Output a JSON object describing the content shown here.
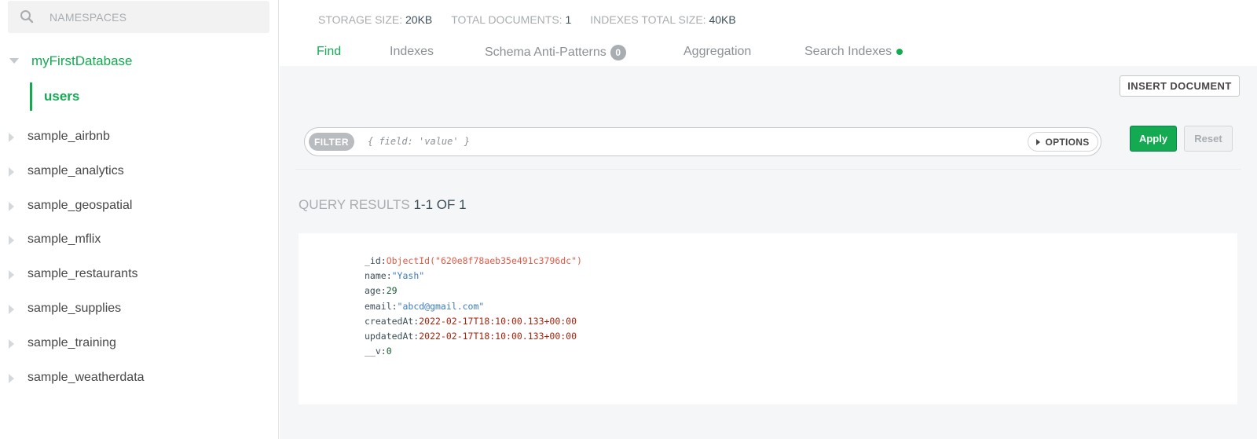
{
  "sidebar": {
    "search_label": "NAMESPACES",
    "active_database": "myFirstDatabase",
    "active_collection": "users",
    "databases": [
      {
        "label": "sample_airbnb"
      },
      {
        "label": "sample_analytics"
      },
      {
        "label": "sample_geospatial"
      },
      {
        "label": "sample_mflix"
      },
      {
        "label": "sample_restaurants"
      },
      {
        "label": "sample_supplies"
      },
      {
        "label": "sample_training"
      },
      {
        "label": "sample_weatherdata"
      }
    ]
  },
  "stats": {
    "storage_label": "STORAGE SIZE:",
    "storage_value": "20KB",
    "docs_label": "TOTAL DOCUMENTS:",
    "docs_value": "1",
    "indexes_label": "INDEXES TOTAL SIZE:",
    "indexes_value": "40KB"
  },
  "tabs": [
    {
      "label": "Find"
    },
    {
      "label": "Indexes"
    },
    {
      "label": "Schema Anti-Patterns",
      "badge": "0"
    },
    {
      "label": "Aggregation"
    },
    {
      "label": "Search Indexes"
    }
  ],
  "toolbar": {
    "insert_label": "INSERT DOCUMENT",
    "filter_pill": "FILTER",
    "filter_placeholder": "{ field: 'value' }",
    "options_label": "OPTIONS",
    "apply_label": "Apply",
    "reset_label": "Reset"
  },
  "results": {
    "label": "QUERY RESULTS",
    "count": "1-1 OF 1"
  },
  "document": {
    "fields": [
      {
        "key": "_id:",
        "value": "ObjectId(\"620e8f78aeb35e491c3796dc\")"
      },
      {
        "key": "name:",
        "value": "\"Yash\""
      },
      {
        "key": "age:",
        "value": "29"
      },
      {
        "key": "email:",
        "value": "\"abcd@gmail.com\""
      },
      {
        "key": "createdAt:",
        "value": "2022-02-17T18:10:00.133+00:00"
      },
      {
        "key": "updatedAt:",
        "value": "2022-02-17T18:10:00.133+00:00"
      },
      {
        "key": "__v:",
        "value": "0"
      }
    ]
  },
  "colors": {
    "accent": "#13aa52",
    "object_id": "#e35b48",
    "string": "#3b7bbf",
    "date": "#a8230c"
  }
}
